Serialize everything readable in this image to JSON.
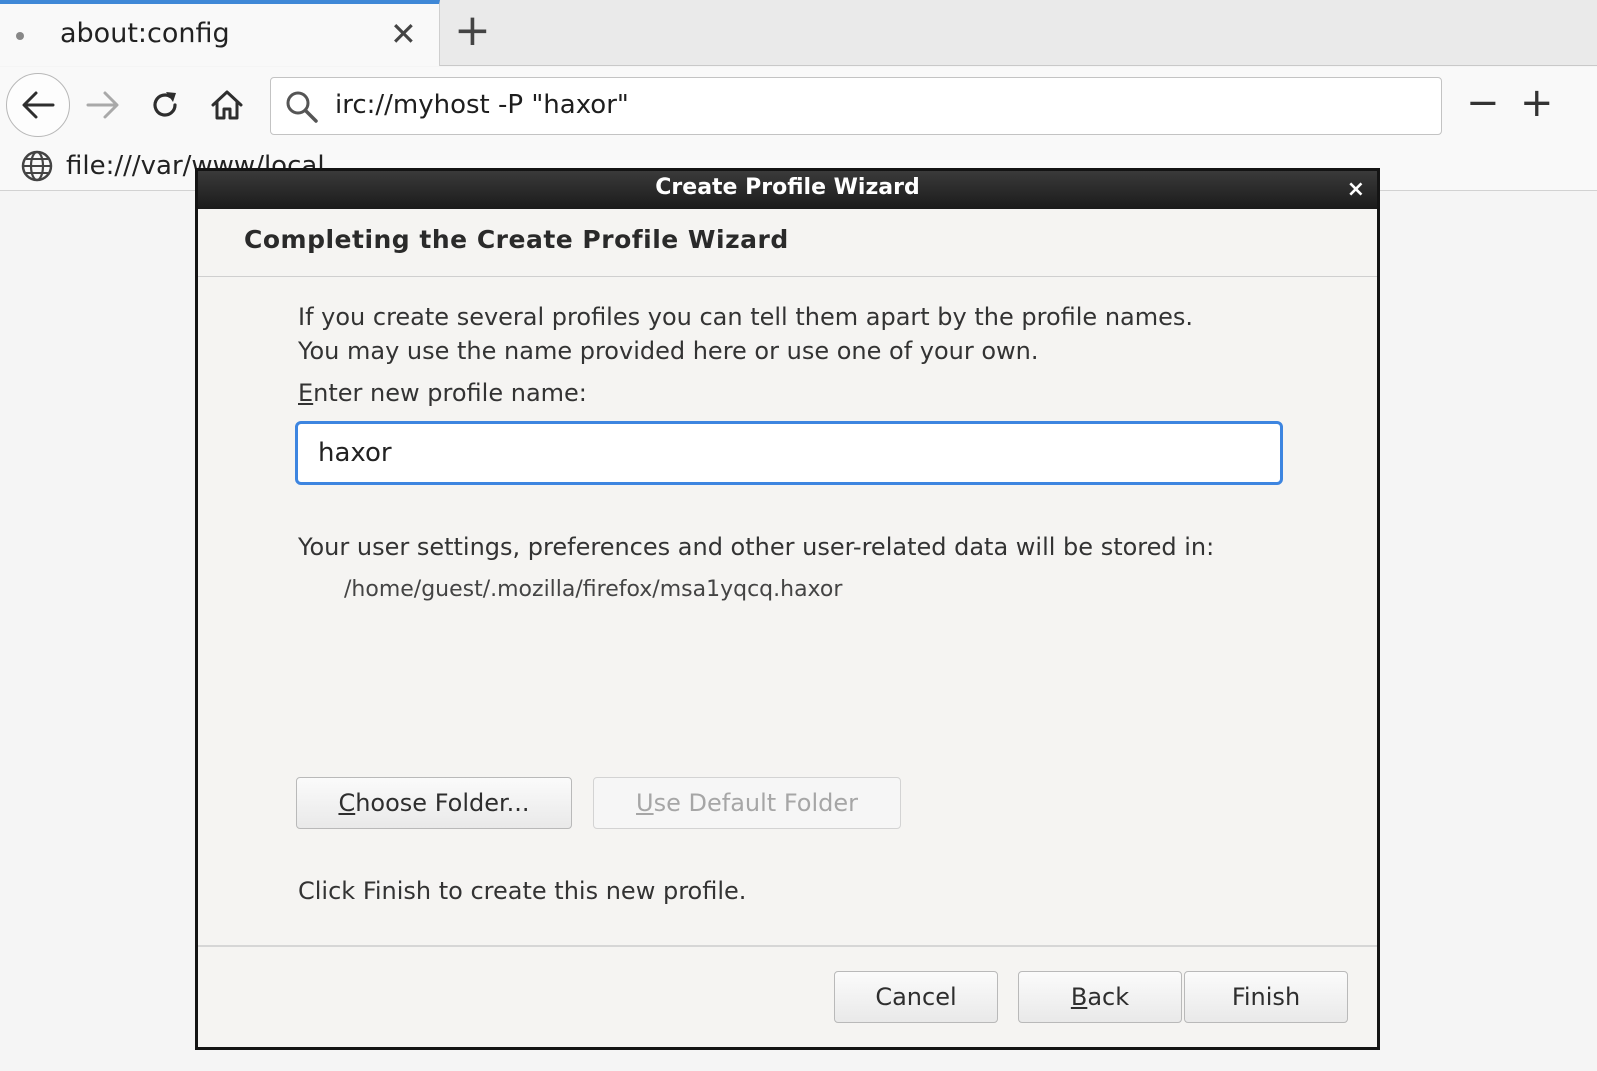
{
  "browser": {
    "tab": {
      "title": "about:config",
      "close_glyph": "✕"
    },
    "new_tab_glyph": "+",
    "url": "irc://myhost -P \"haxor\"",
    "zoom_out_glyph": "−",
    "zoom_in_glyph": "+",
    "bookmark": {
      "label": "file:///var/www/local",
      "icon": "globe-icon"
    },
    "icons": [
      "back-arrow-icon",
      "forward-arrow-icon",
      "reload-icon",
      "home-icon",
      "search-icon"
    ]
  },
  "dialog": {
    "title": "Create Profile Wizard",
    "close_glyph": "×",
    "heading": "Completing the Create Profile Wizard",
    "description_line1": "If you create several profiles you can tell them apart by the profile names.",
    "description_line2": "You may use the name provided here or use one of your own.",
    "name_label_accel": "E",
    "name_label_rest": "nter new profile name:",
    "profile_name": "haxor",
    "store_label": "Your user settings, preferences and other user-related data will be stored in:",
    "store_path": "/home/guest/.mozilla/firefox/msa1yqcq.haxor",
    "choose_folder_accel": "C",
    "choose_folder_rest": "hoose Folder...",
    "default_folder_accel": "U",
    "default_folder_rest": "se Default Folder",
    "finish_hint": "Click Finish to create this new profile.",
    "cancel_label": "Cancel",
    "back_accel": "B",
    "back_rest": "ack",
    "finish_label": "Finish"
  },
  "colors": {
    "accent": "#3d85e0",
    "tab_indicator": "#3f88d7",
    "titlebar": "#1b1b1b"
  }
}
